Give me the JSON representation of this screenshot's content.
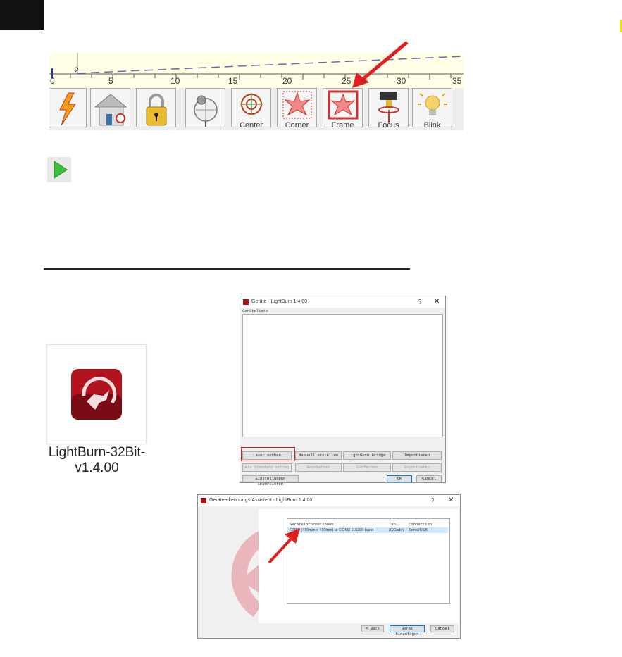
{
  "toolbar": {
    "ruler_numbers": [
      "0",
      "2",
      "5",
      "10",
      "15",
      "20",
      "25",
      "30",
      "35"
    ],
    "buttons": [
      {
        "icon": "lightning-icon",
        "label": ""
      },
      {
        "icon": "home-icon",
        "label": ""
      },
      {
        "icon": "lock-icon",
        "label": ""
      },
      {
        "icon": "globe-pin-icon",
        "label": ""
      },
      {
        "icon": "center-target-icon",
        "label": "Center"
      },
      {
        "icon": "corner-star-icon",
        "label": "Corner"
      },
      {
        "icon": "frame-icon",
        "label": "Frame"
      },
      {
        "icon": "focus-icon",
        "label": "Focus"
      },
      {
        "icon": "blink-bulb-icon",
        "label": "Blink"
      }
    ]
  },
  "app_icon": {
    "caption_line1": "LightBurn-32Bit-",
    "caption_line2": "v1.4.00"
  },
  "devices_dialog": {
    "title": "Geräte - LightBurn 1.4.00",
    "help": "?",
    "close": "✕",
    "list_header": "Geräteliste",
    "buttons_row1": [
      "Laser suchen",
      "Manuell erstellen",
      "LightBurn Bridge",
      "Importieren"
    ],
    "buttons_row2": [
      "Als Standard setzen",
      "Bearbeiten",
      "Entfernen",
      "Exportieren"
    ],
    "import_settings": "Einstellungen importieren",
    "ok": "OK",
    "cancel": "Cancel"
  },
  "wizard_dialog": {
    "title": "Geräteerkennungs-Assistent - LightBurn 1.4.00",
    "help": "?",
    "close": "✕",
    "columns": [
      "Geräteinformationen",
      "Typ",
      "Connection"
    ],
    "rows": [
      {
        "info": "GRBL (410mm x 410mm) at COM3 115200 baud",
        "type": "(GCode)",
        "connection": "Serial/USB"
      }
    ],
    "back": "< Back",
    "add_device": "Gerät hinzufügen",
    "cancel": "Cancel"
  },
  "colors": {
    "arrow": "#e02020",
    "highlight_box": "#d62020",
    "selection": "#cce8ff",
    "lightburn_red": "#b3121f"
  }
}
